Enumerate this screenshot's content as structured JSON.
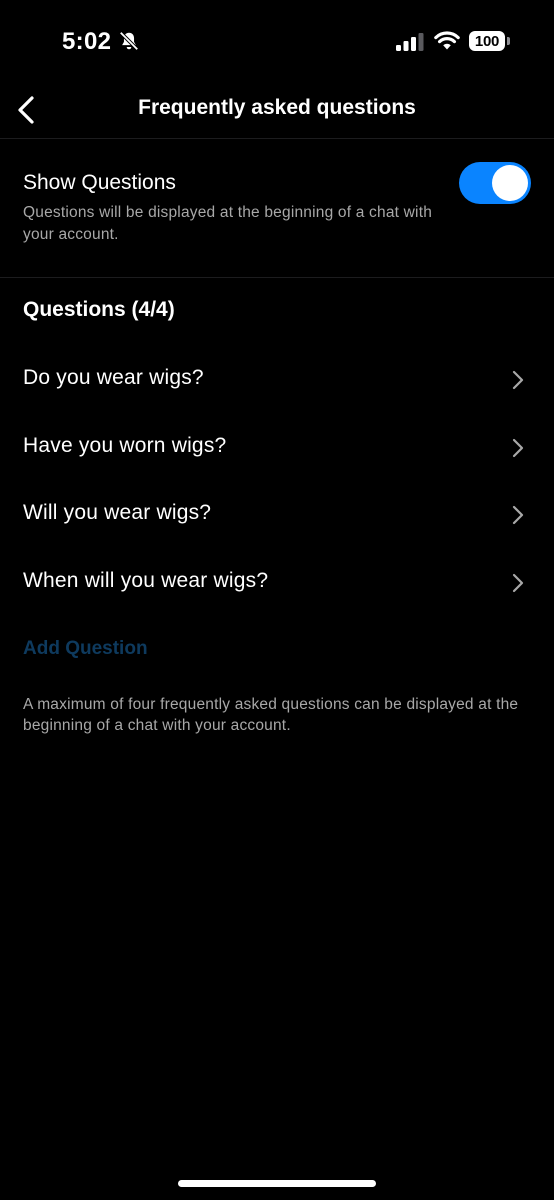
{
  "status_bar": {
    "time": "5:02",
    "battery": "100",
    "icons": [
      "bell-slash-icon",
      "signal-icon",
      "wifi-icon",
      "battery-icon"
    ]
  },
  "header": {
    "back_icon": "chevron-left-icon",
    "title": "Frequently asked questions"
  },
  "toggle": {
    "label": "Show Questions",
    "description": "Questions will be displayed at the beginning of a chat with your account.",
    "enabled": true,
    "color": "#0a84ff"
  },
  "questions": {
    "heading": "Questions (4/4)",
    "items": [
      {
        "label": "Do you wear wigs?"
      },
      {
        "label": "Have you worn wigs?"
      },
      {
        "label": "Will you wear wigs?"
      },
      {
        "label": "When will you wear wigs?"
      }
    ],
    "add_label": "Add Question",
    "add_color": "#0e3a5e",
    "footer": "A maximum of four frequently asked questions can be displayed at the beginning of a chat with your account."
  }
}
